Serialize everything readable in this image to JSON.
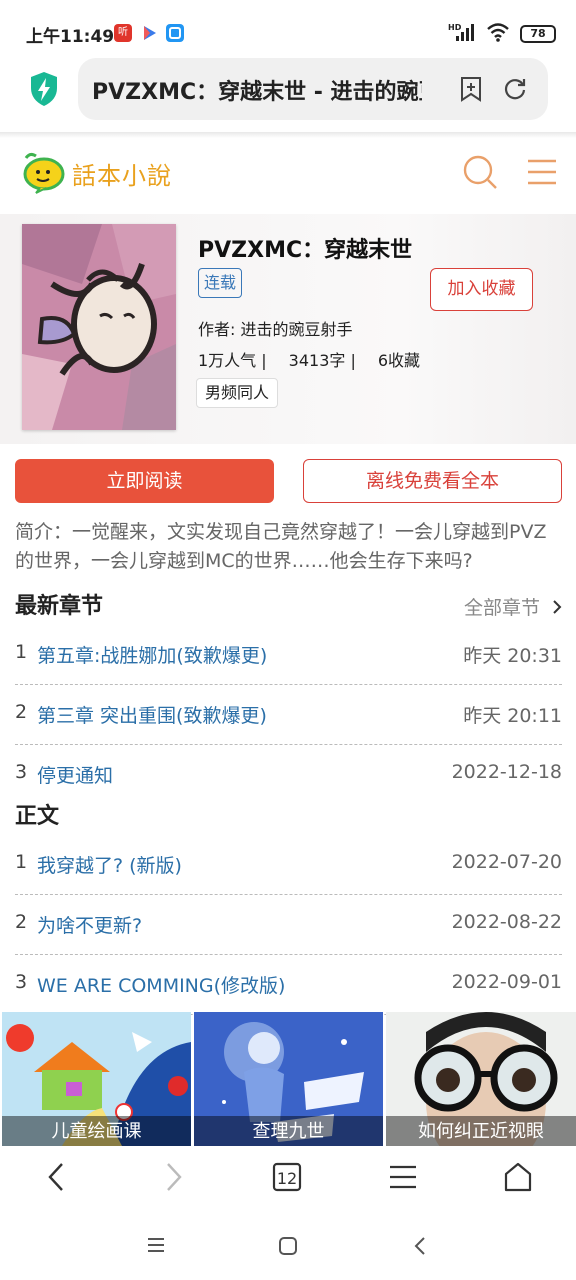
{
  "status_bar": {
    "time": "上午11:49",
    "network": "HD",
    "battery": "78"
  },
  "browser": {
    "address_title": "PVZXMC：穿越末世 - 进击的豌豆射手"
  },
  "site": {
    "logo_text": "話本小說"
  },
  "book": {
    "title": "PVZXMC：穿越末世",
    "status_tag": "连载",
    "favorite_button": "加入收藏",
    "author": "作者: 进击的豌豆射手",
    "popularity": "1万人气 |",
    "word_count": "3413字 |",
    "favorites": "6收藏",
    "category": "男频同人"
  },
  "actions": {
    "read_now": "立即阅读",
    "offline_free": "离线免费看全本"
  },
  "intro": "简介：一觉醒来，文实发现自己竟然穿越了！一会儿穿越到PVZ的世界，一会儿穿越到MC的世界……他会生存下来吗?",
  "latest": {
    "title": "最新章节",
    "all_chapters": "全部章节",
    "items": [
      {
        "num": "1",
        "name": "第五章:战胜娜加(致歉爆更)",
        "date": "昨天 20:31"
      },
      {
        "num": "2",
        "name": "第三章 突出重围(致歉爆更)",
        "date": "昨天 20:11"
      },
      {
        "num": "3",
        "name": "停更通知",
        "date": "2022-12-18"
      }
    ]
  },
  "main": {
    "title": "正文",
    "items": [
      {
        "num": "1",
        "name": "我穿越了? (新版)",
        "date": "2022-07-20"
      },
      {
        "num": "2",
        "name": "为啥不更新?",
        "date": "2022-08-22"
      },
      {
        "num": "3",
        "name": "WE ARE COMMING(修改版)",
        "date": "2022-09-01"
      }
    ]
  },
  "ads": [
    {
      "caption": "儿童绘画课"
    },
    {
      "caption": "查理九世"
    },
    {
      "caption": "如何纠正近视眼"
    }
  ],
  "toolbar": {
    "tabs_count": "12"
  },
  "colors": {
    "accent_red": "#e8523b",
    "link_blue": "#2b6fa8",
    "logo_orange": "#e9a11e"
  }
}
